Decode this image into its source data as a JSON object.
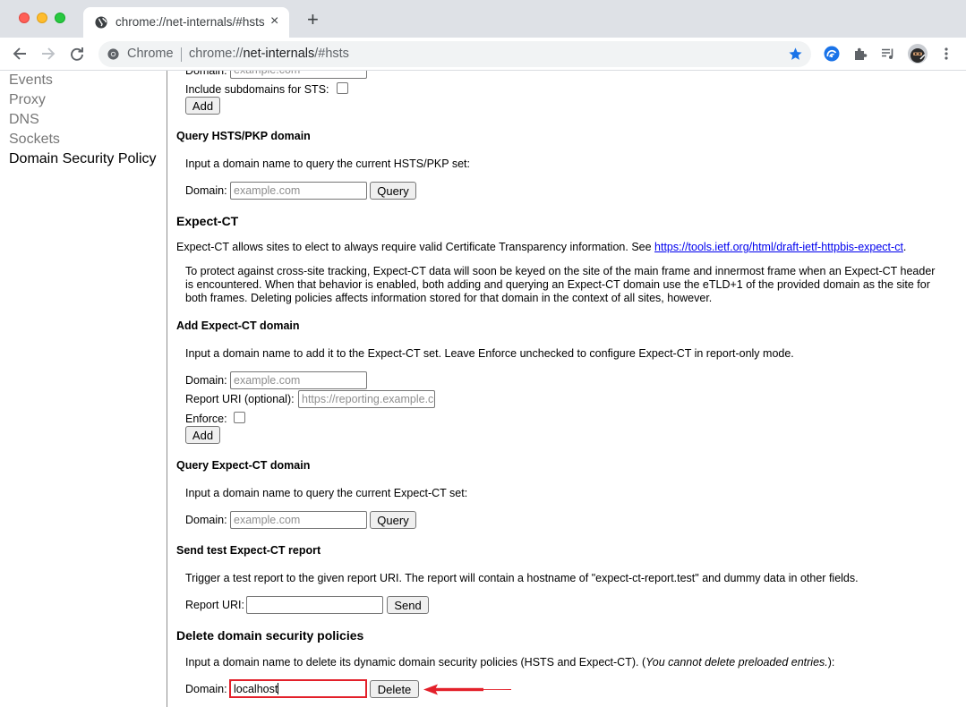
{
  "window": {
    "tab_title": "chrome://net-internals/#hsts",
    "new_tab_label": "+",
    "tab_close_label": "×"
  },
  "toolbar": {
    "omnibox_chip": "Chrome",
    "url_scheme": "chrome://",
    "url_host": "net-internals",
    "url_path": "/#hsts",
    "accent_color": "#1a73e8"
  },
  "sidebar": {
    "items": [
      {
        "label": "Events",
        "active": false
      },
      {
        "label": "Proxy",
        "active": false
      },
      {
        "label": "DNS",
        "active": false
      },
      {
        "label": "Sockets",
        "active": false
      },
      {
        "label": "Domain Security Policy",
        "active": true
      }
    ]
  },
  "hsts_add": {
    "domain_label": "Domain:",
    "domain_placeholder": "example.com",
    "subdomains_label": "Include subdomains for STS:",
    "add_button": "Add"
  },
  "hsts_query": {
    "heading": "Query HSTS/PKP domain",
    "description": "Input a domain name to query the current HSTS/PKP set:",
    "domain_label": "Domain:",
    "domain_placeholder": "example.com",
    "query_button": "Query"
  },
  "expect_ct": {
    "heading": "Expect-CT",
    "intro": "Expect-CT allows sites to elect to always require valid Certificate Transparency information. See ",
    "intro_link": "https://tools.ietf.org/html/draft-ietf-httpbis-expect-ct",
    "intro_end": ".",
    "notice_line1": "To protect against cross-site tracking, Expect-CT data will soon be keyed on the site of the main frame and innermost frame when an Expect-CT header",
    "notice_line2": "is encountered. When that behavior is enabled, both adding and querying an Expect-CT domain use the eTLD+1 of the provided domain as the site for",
    "notice_line3": "both frames. Deleting policies affects information stored for that domain in the context of all sites, however."
  },
  "expect_ct_add": {
    "heading": "Add Expect-CT domain",
    "description": "Input a domain name to add it to the Expect-CT set. Leave Enforce unchecked to configure Expect-CT in report-only mode.",
    "domain_label": "Domain:",
    "domain_placeholder": "example.com",
    "report_uri_label": "Report URI (optional):",
    "report_uri_placeholder": "https://reporting.example.com",
    "enforce_label": "Enforce:",
    "add_button": "Add"
  },
  "expect_ct_query": {
    "heading": "Query Expect-CT domain",
    "description": "Input a domain name to query the current Expect-CT set:",
    "domain_label": "Domain:",
    "domain_placeholder": "example.com",
    "query_button": "Query"
  },
  "expect_ct_test": {
    "heading": "Send test Expect-CT report",
    "description": "Trigger a test report to the given report URI. The report will contain a hostname of \"expect-ct-report.test\" and dummy data in other fields.",
    "report_uri_label": "Report URI:",
    "report_uri_value": "",
    "send_button": "Send"
  },
  "delete_policies": {
    "heading": "Delete domain security policies",
    "description_start": "Input a domain name to delete its dynamic domain security policies (HSTS and Expect-CT). (",
    "description_italic": "You cannot delete preloaded entries.",
    "description_end": "):",
    "domain_label": "Domain:",
    "domain_value": "localhost",
    "delete_button": "Delete",
    "annotation_color": "#e3202a"
  }
}
